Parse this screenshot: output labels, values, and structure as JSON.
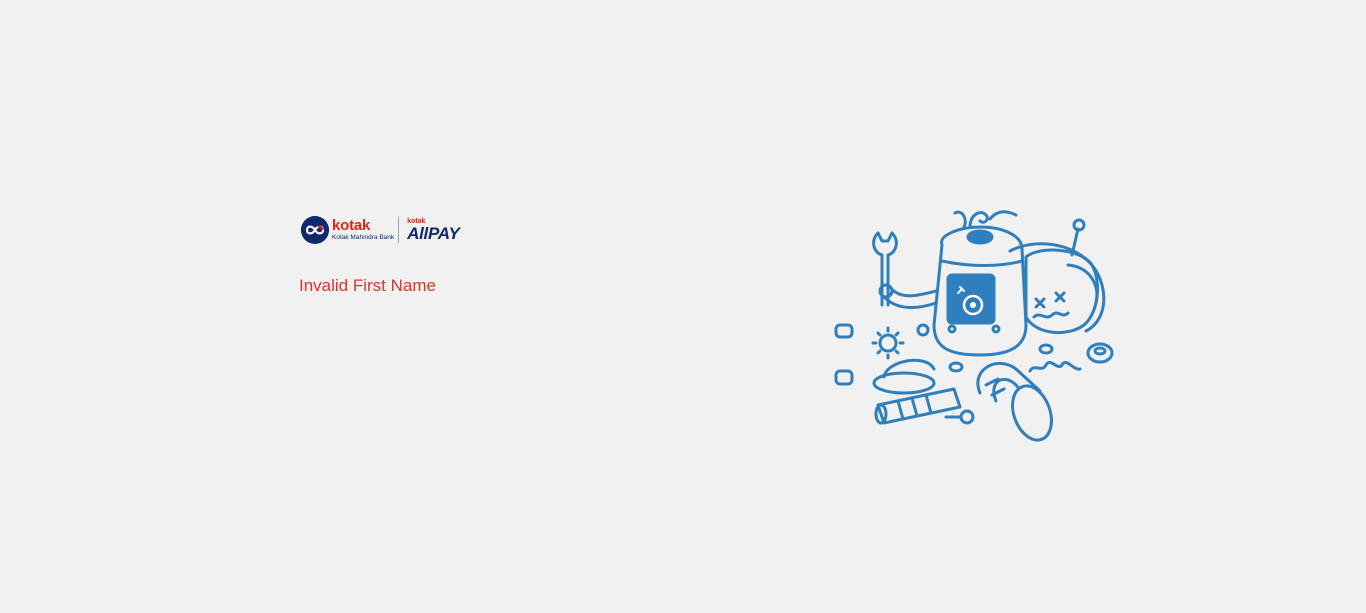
{
  "brand": {
    "bank_name": "kotak",
    "bank_subtitle": "Kotak Mahindra Bank",
    "product_prefix": "kotak",
    "product_name": "AllPAY"
  },
  "error": {
    "message": "Invalid First Name"
  },
  "illustration": {
    "icon": "broken-robot-illustration"
  },
  "colors": {
    "background": "#f1f1f1",
    "error_text": "#e0322b",
    "brand_navy": "#0e2a6b",
    "brand_red": "#e2231a",
    "illustration_blue": "#2f7fbf"
  }
}
